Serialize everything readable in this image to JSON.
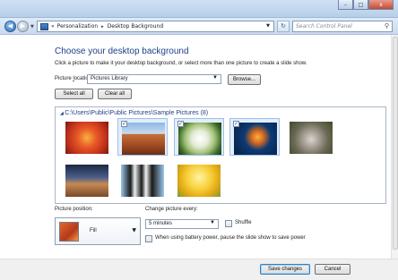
{
  "window": {
    "caption_minimize": "–",
    "caption_maximize": "□",
    "caption_close": "x"
  },
  "nav": {
    "back_icon": "back-arrow-icon",
    "forward_icon": "forward-arrow-icon",
    "address_prefix": "«",
    "breadcrumb": [
      "Personalization",
      "Desktop Background"
    ],
    "breadcrumb_sep": "▸",
    "search_placeholder": "Search Control Panel"
  },
  "page": {
    "heading": "Choose your desktop background",
    "subtitle": "Click a picture to make it your desktop background, or select more than one picture to create a slide show."
  },
  "location": {
    "label_pre": "Picture ",
    "label_ul": "l",
    "label_post": "ocation:",
    "value": "Pictures Library",
    "browse_label": "Browse...",
    "select_all_label": "Select all",
    "clear_all_label": "Clear all"
  },
  "gallery": {
    "folder": "C:\\Users\\Public\\Public Pictures\\Sample Pictures (8)",
    "pictures": [
      {
        "name": "Chrysanthemum",
        "checked": false
      },
      {
        "name": "Desert",
        "checked": true
      },
      {
        "name": "Hydrangeas",
        "checked": true
      },
      {
        "name": "Jellyfish",
        "checked": true
      },
      {
        "name": "Koala",
        "checked": false
      },
      {
        "name": "Lighthouse",
        "checked": false
      },
      {
        "name": "Penguins",
        "checked": false
      },
      {
        "name": "Tulips",
        "checked": false
      }
    ]
  },
  "position": {
    "label": "Picture position:",
    "value": "Fill"
  },
  "slideshow": {
    "change_label": "Change picture every:",
    "interval": "5 minutes",
    "shuffle_label": "Shuffle",
    "battery_label": "When using battery power, pause the slide show to save power"
  },
  "footer": {
    "save_label": "Save changes",
    "cancel_label": "Cancel"
  },
  "colors": {
    "accent": "#1e3f8a",
    "selection": "#e3eefb"
  }
}
